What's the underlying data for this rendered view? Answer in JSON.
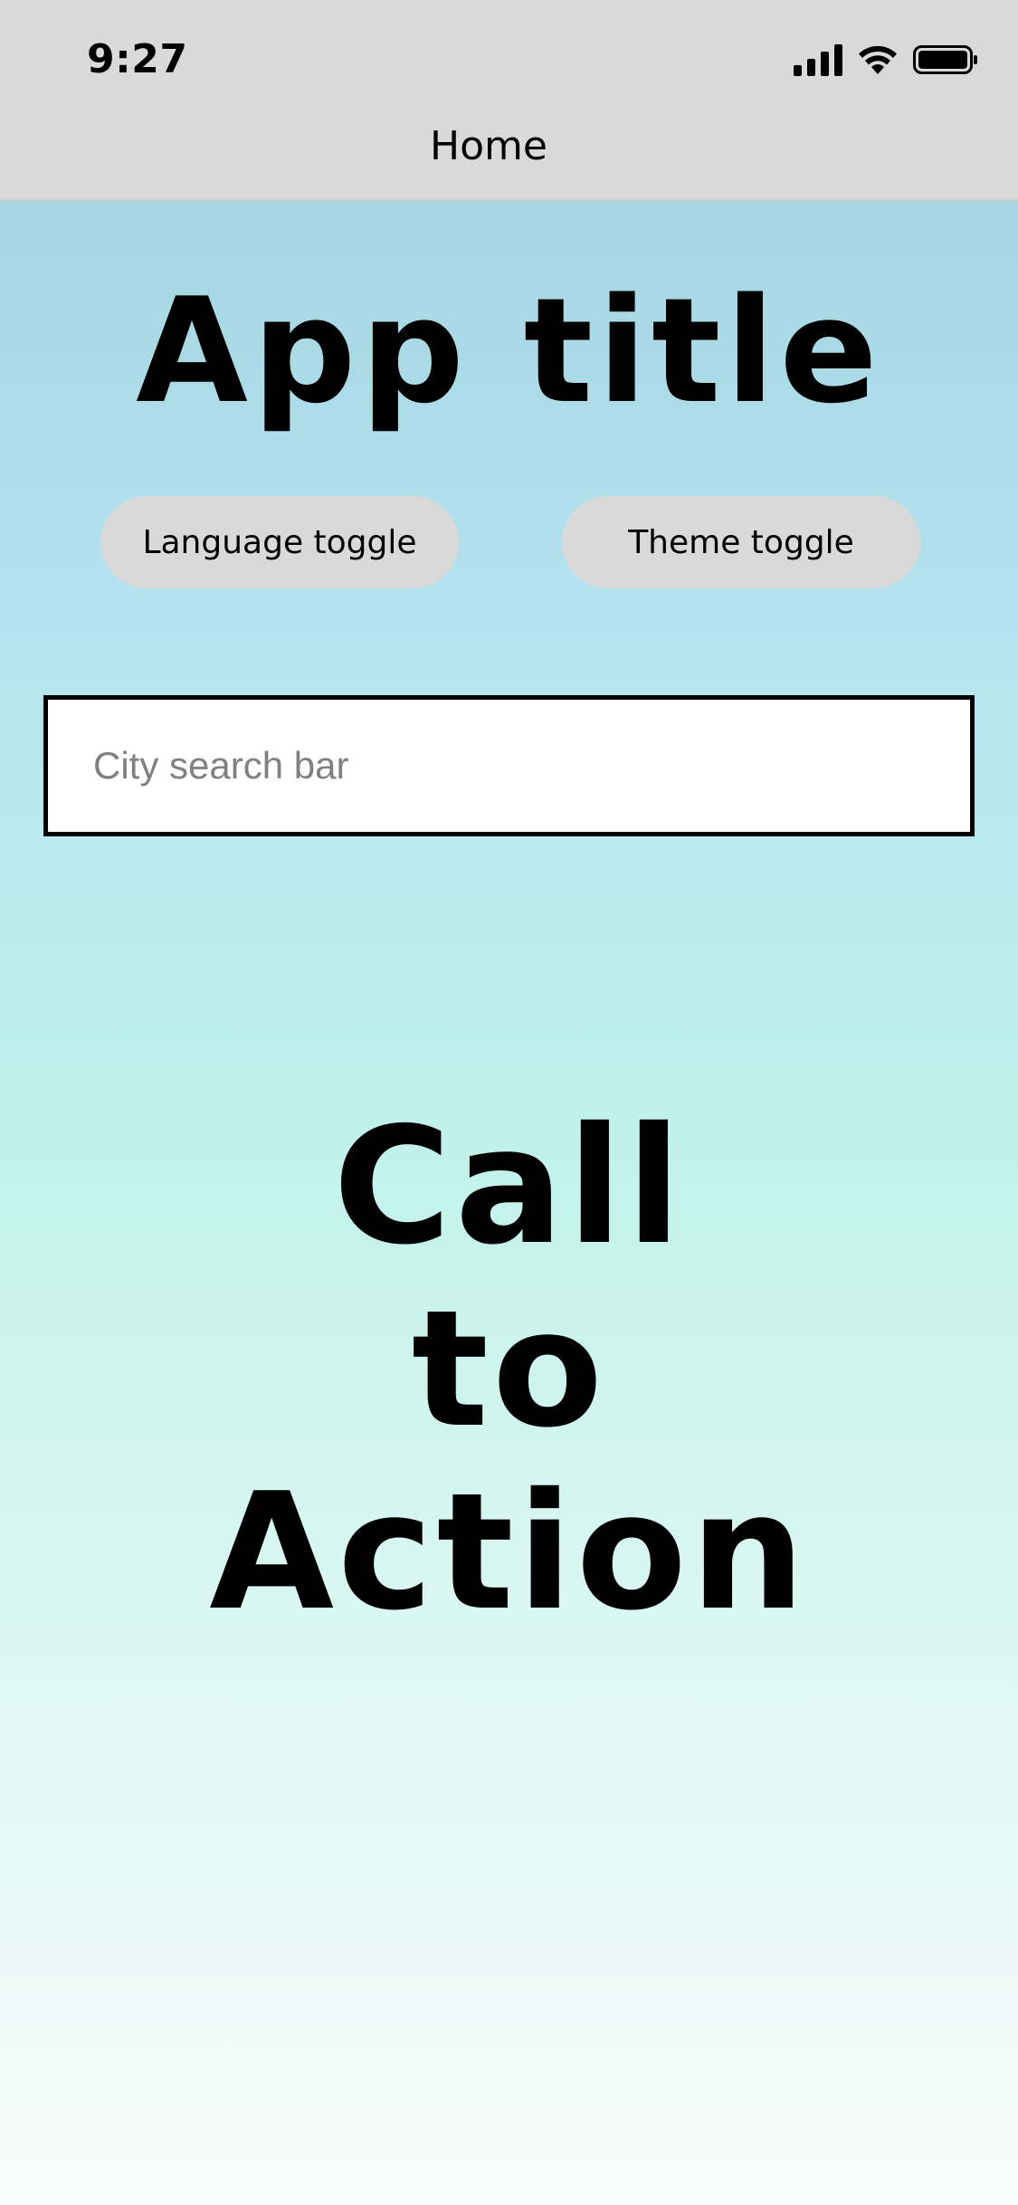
{
  "status_bar": {
    "time": "9:27",
    "icons": [
      "signal-icon",
      "wifi-icon",
      "battery-icon"
    ]
  },
  "nav": {
    "title": "Home"
  },
  "main": {
    "app_title": "App title",
    "language_toggle_label": "Language toggle",
    "theme_toggle_label": "Theme toggle",
    "search": {
      "placeholder": "City search bar",
      "value": ""
    },
    "cta_lines": [
      "Call",
      "to",
      "Action"
    ]
  },
  "colors": {
    "header_bg": "#d9d9d9",
    "button_bg": "#d9d9d9",
    "gradient_top": "#9fcfdc",
    "gradient_bottom": "#f8fdfb"
  }
}
